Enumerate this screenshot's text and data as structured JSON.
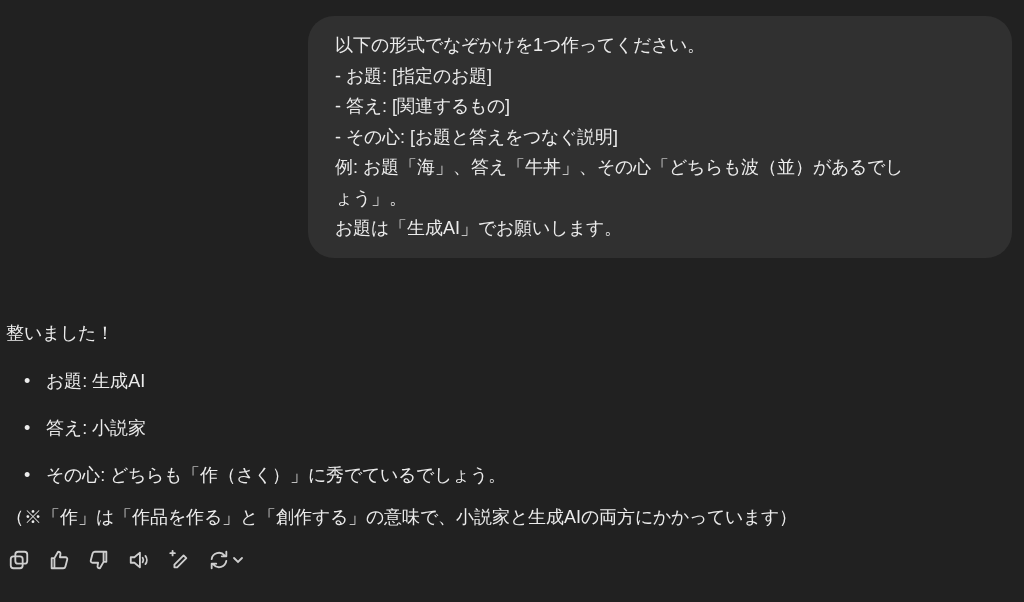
{
  "user_message": {
    "lines": [
      "以下の形式でなぞかけを1つ作ってください。",
      "- お題: [指定のお題]",
      "- 答え: [関連するもの]",
      "- その心: [お題と答えをつなぐ説明]",
      "例: お題「海」、答え「牛丼」、その心「どちらも波（並）があるでしょう」。",
      "お題は「生成AI」でお願いします。"
    ]
  },
  "assistant_message": {
    "intro": "整いました！",
    "bullets": [
      {
        "marker": "•",
        "text": "お題: 生成AI"
      },
      {
        "marker": "•",
        "text": "答え: 小説家"
      },
      {
        "marker": "•",
        "text": "その心: どちらも「作（さく）」に秀でているでしょう。"
      }
    ],
    "note": "（※「作」は「作品を作る」と「創作する」の意味で、小説家と生成AIの両方にかかっています）"
  }
}
